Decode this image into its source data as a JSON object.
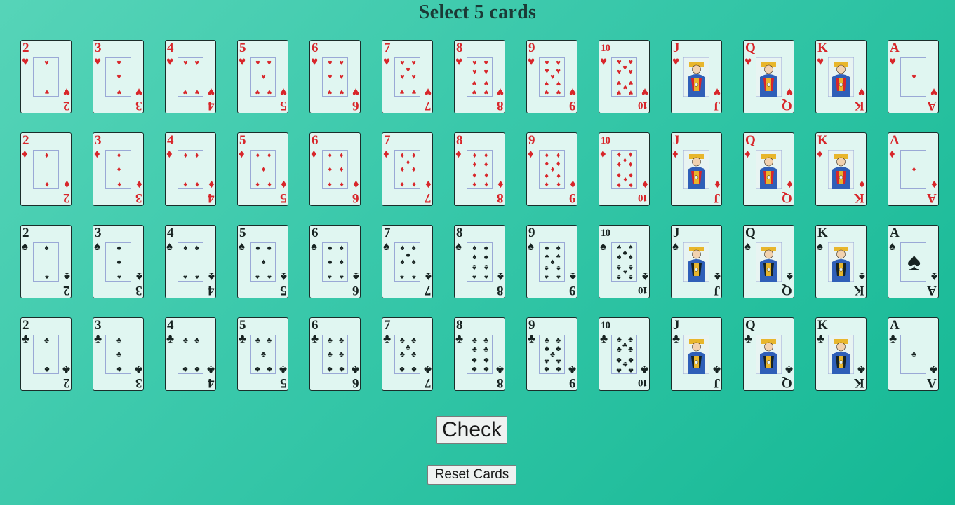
{
  "title": "Select 5 cards",
  "ranks": [
    "2",
    "3",
    "4",
    "5",
    "6",
    "7",
    "8",
    "9",
    "10",
    "J",
    "Q",
    "K",
    "A"
  ],
  "suits": [
    {
      "name": "hearts",
      "symbol": "♥",
      "color": "#d8262a"
    },
    {
      "name": "diamonds",
      "symbol": "♦",
      "color": "#d8262a"
    },
    {
      "name": "spades",
      "symbol": "♠",
      "color": "#172321"
    },
    {
      "name": "clubs",
      "symbol": "♣",
      "color": "#172321"
    }
  ],
  "buttons": {
    "check_label": "Check",
    "reset_label": "Reset Cards"
  }
}
